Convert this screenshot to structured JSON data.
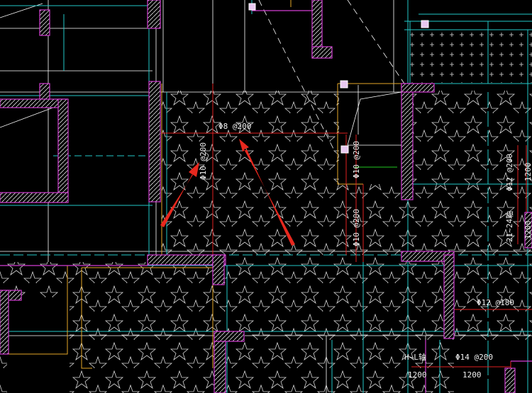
{
  "annotations": {
    "rebar_top": "Φ8 @200",
    "rebar_left_vertical": "Φ10 @200",
    "rebar_center_upper": "Φ10 @200",
    "rebar_center_lower": "Φ10 @200",
    "rebar_right": "Φ12 @200",
    "dim_right_1200_top": "1200",
    "axis_range_right": "21~24轴",
    "dim_right_1200_bottom": "1200",
    "rebar_right_lower": "Φ12 @180",
    "axis_range_bottom": "H~L轴",
    "rebar_bottom": "Φ14 @200",
    "dim_bottom_left": "1200",
    "dim_bottom_right": "1200"
  },
  "colors": {
    "background": "#000000",
    "wall": "#d23cd2",
    "hatch_fill": "#ffffff",
    "rebar_line": "#e02020",
    "cyan_line": "#22c8c8",
    "orange_line": "#e6a828",
    "white_line": "#ffffff",
    "green_line": "#22c822",
    "arrow": "#e8281e",
    "text": "#f0f0f0"
  },
  "pointer_arrows": [
    "arrow",
    "arrow"
  ]
}
